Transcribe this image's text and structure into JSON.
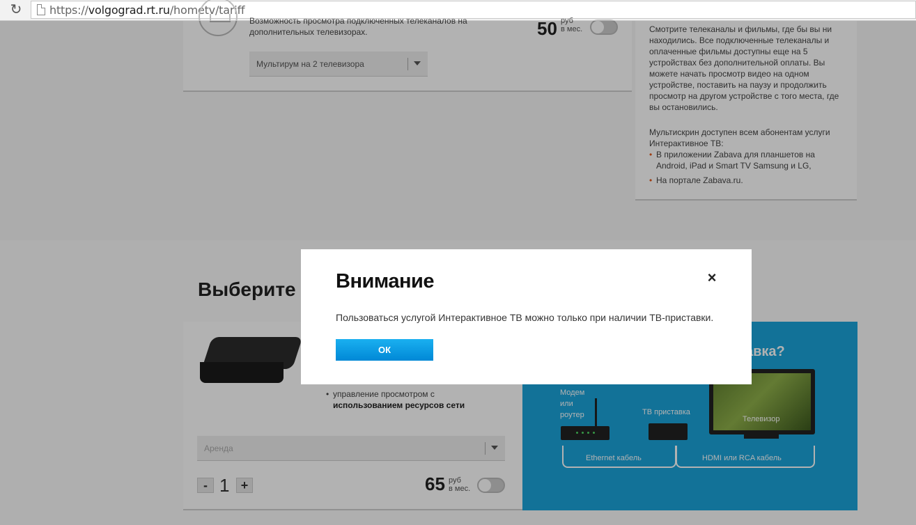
{
  "browser": {
    "url_scheme": "https://",
    "url_host": "volgograd.rt.ru",
    "url_path": "/hometv/tariff"
  },
  "multiroom": {
    "description": "Возможность просмотра подключенных телеканалов на дополнительных телевизорах.",
    "price": "50",
    "price_unit_line1": "руб",
    "price_unit_line2": "в мес.",
    "select_value": "Мультирум на 2 телевизора"
  },
  "multiscreen_info": {
    "paragraph1": "Смотрите телеканалы и фильмы, где бы вы ни находились. Все подключенные телеканалы и оплаченные фильмы доступны еще на 5 устройствах без дополнительной оплаты. Вы можете начать просмотр видео на одном устройстве, поставить на паузу и продолжить просмотр на другом устройстве с того места, где вы остановились.",
    "paragraph2": "Мультискрин доступен всем абонентам услуги Интерактивное ТВ:",
    "items": [
      "В приложении Zabava для планшетов на Android, iPad и Smart TV Samsung и LG,",
      "На портале Zabava.ru."
    ]
  },
  "equipment": {
    "section_title": "Выберите о",
    "feature_text": "управление просмотром с",
    "feature_bold": "использованием ресурсов сети",
    "select_value": "Аренда",
    "quantity": "1",
    "minus_label": "-",
    "plus_label": "+",
    "price": "65",
    "price_unit_line1": "руб",
    "price_unit_line2": "в мес."
  },
  "diagram": {
    "title": "авка?",
    "router_label": "Модем\nили\nроутер",
    "stb_label": "ТВ приставка",
    "tv_label": "Телевизор",
    "cable1": "Ethernet кабель",
    "cable2": "HDMI или RCA кабель",
    "bg_color": "#1ba4da"
  },
  "modal": {
    "title": "Внимание",
    "message": "Пользоваться услугой Интерактивное ТВ можно только при наличии ТВ-приставки.",
    "ok_label": "ОК",
    "close_symbol": "×",
    "accent_color": "#0a9de6"
  }
}
